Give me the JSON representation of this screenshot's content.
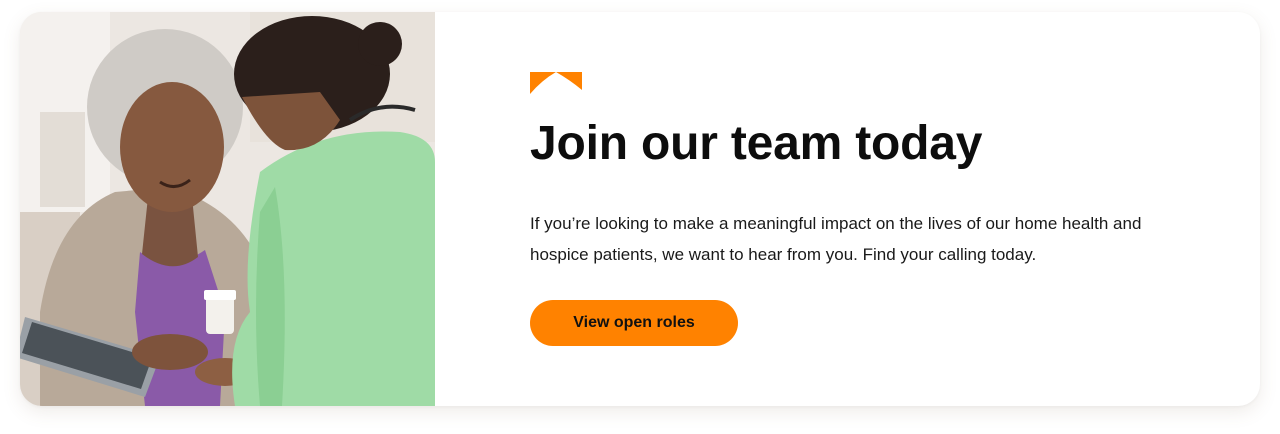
{
  "promo": {
    "heading": "Join our team today",
    "description": "If you’re looking to make a meaningful impact on the lives of our home health and hospice patients, we want to hear from you. Find your calling today.",
    "cta_label": "View open roles",
    "accent_color": "#ff8200",
    "photo_alt": "Caregiver in green scrubs helping an older woman with a tablet and medication",
    "accent_icon": "chevron-banner-icon"
  }
}
